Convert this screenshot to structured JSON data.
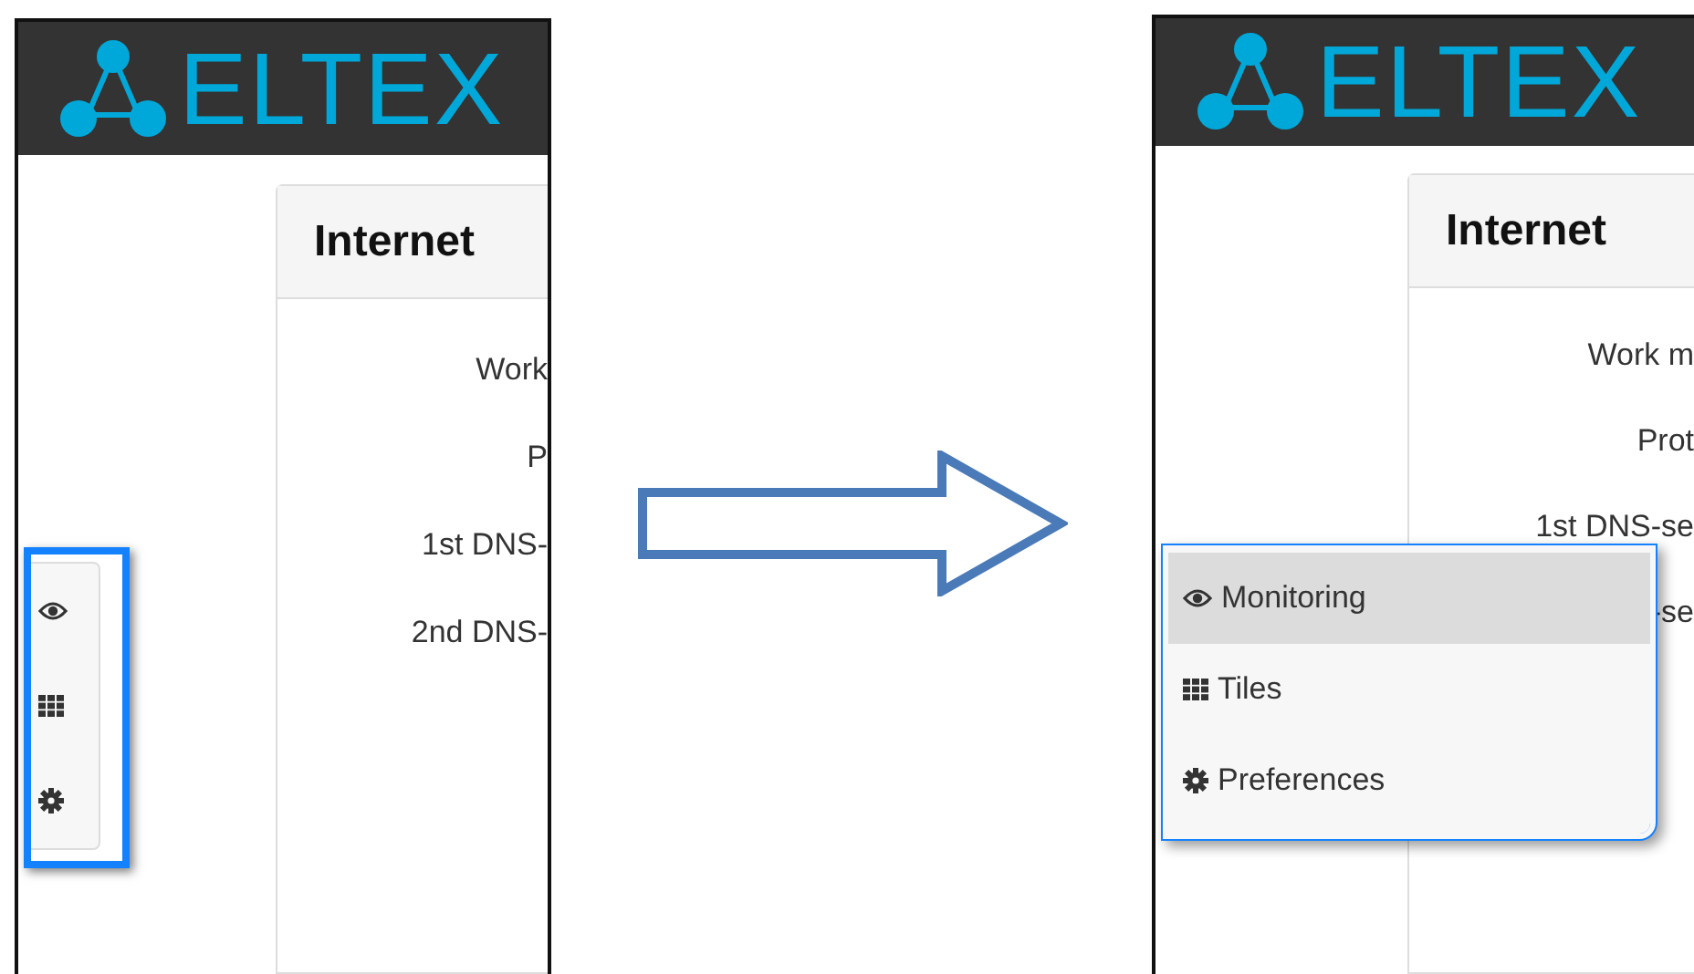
{
  "panels": [
    {
      "logo": "ELTEX",
      "card_title": "Internet",
      "fields": [
        "Work",
        "P",
        "1st DNS-",
        "2nd DNS-"
      ],
      "menu": {
        "expanded": false,
        "items": [
          {
            "kind": "eye"
          },
          {
            "kind": "grid"
          },
          {
            "kind": "gear"
          }
        ]
      }
    },
    {
      "logo": "ELTEX",
      "card_title": "Internet",
      "fields": [
        "Work m",
        "Prot",
        "1st DNS-se",
        "-se"
      ],
      "menu": {
        "expanded": true,
        "items": [
          {
            "kind": "eye",
            "label": "Monitoring",
            "selected": true
          },
          {
            "kind": "grid",
            "label": "Tiles",
            "selected": false
          },
          {
            "kind": "gear",
            "label": "Preferences",
            "selected": false
          }
        ]
      }
    }
  ]
}
